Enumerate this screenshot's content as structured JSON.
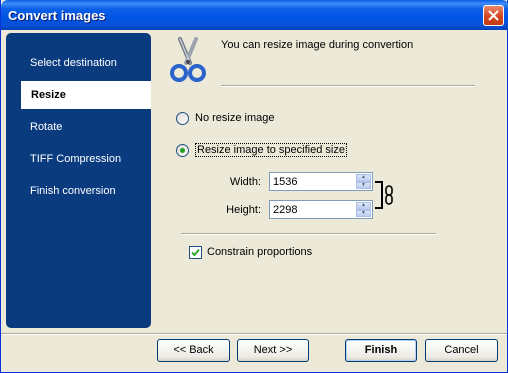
{
  "window": {
    "title": "Convert images"
  },
  "sidebar": {
    "items": [
      {
        "label": "Select destination"
      },
      {
        "label": "Resize"
      },
      {
        "label": "Rotate"
      },
      {
        "label": "TIFF Compression"
      },
      {
        "label": "Finish conversion"
      }
    ],
    "active_index": 1
  },
  "header": {
    "text": "You can resize image during convertion",
    "icon": "scissors-icon"
  },
  "options": {
    "no_resize_label": "No resize image",
    "resize_label": "Resize image to specified size",
    "selected": "resize"
  },
  "size": {
    "width_label": "Width:",
    "width_value": "1536",
    "height_label": "Height:",
    "height_value": "2298"
  },
  "constrain": {
    "label": "Constrain proportions",
    "checked": true
  },
  "buttons": {
    "back": "<< Back",
    "next": "Next >>",
    "finish": "Finish",
    "cancel": "Cancel"
  },
  "colors": {
    "sidebar_bg": "#0a3b7f",
    "titlebar": "#0054e3",
    "close": "#d2461f"
  }
}
